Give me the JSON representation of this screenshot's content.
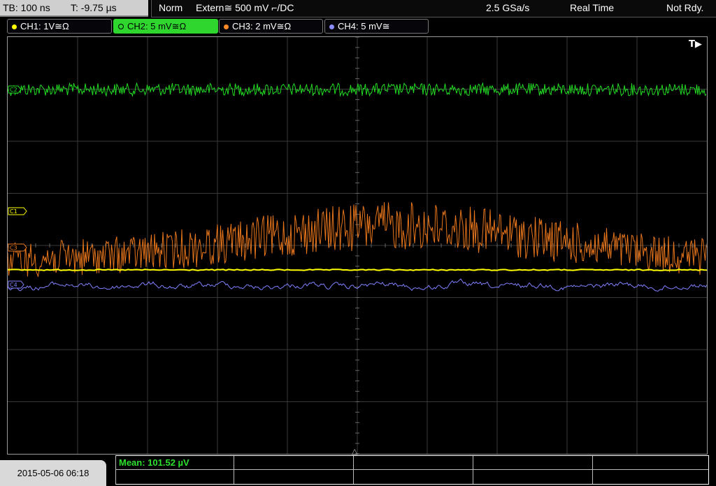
{
  "status": {
    "timebase": "TB: 100 ns",
    "trigger_time": "T: -9.75 µs",
    "mode": "Norm",
    "trigger_source": "Extern≅ 500 mV ⌐/DC",
    "sample_rate": "2.5 GSa/s",
    "acquisition": "Real Time",
    "state": "Not Rdy."
  },
  "channels": [
    {
      "label": "CH1: 1V≅Ω",
      "color": "#ffff00",
      "active": false
    },
    {
      "label": "CH2: 5 mV≅Ω",
      "color": "#2ed62e",
      "active": true
    },
    {
      "label": "CH3: 2 mV≅Ω",
      "color": "#ff8a2a",
      "active": false
    },
    {
      "label": "CH4: 5 mV≅",
      "color": "#8c8cff",
      "active": false
    }
  ],
  "markers": {
    "ch1": "C1",
    "ch2": "C2",
    "ch3": "C3",
    "ch4": "C4",
    "trigger": "T▶"
  },
  "bottom": {
    "datetime": "2015-05-06 06:18",
    "measurement": "Mean: 101.52 µV"
  },
  "colors": {
    "grid": "#3a3a3a",
    "ch1": "#ffff00",
    "ch2": "#22dd22",
    "ch3": "#e8761c",
    "ch4": "#8080ff"
  }
}
